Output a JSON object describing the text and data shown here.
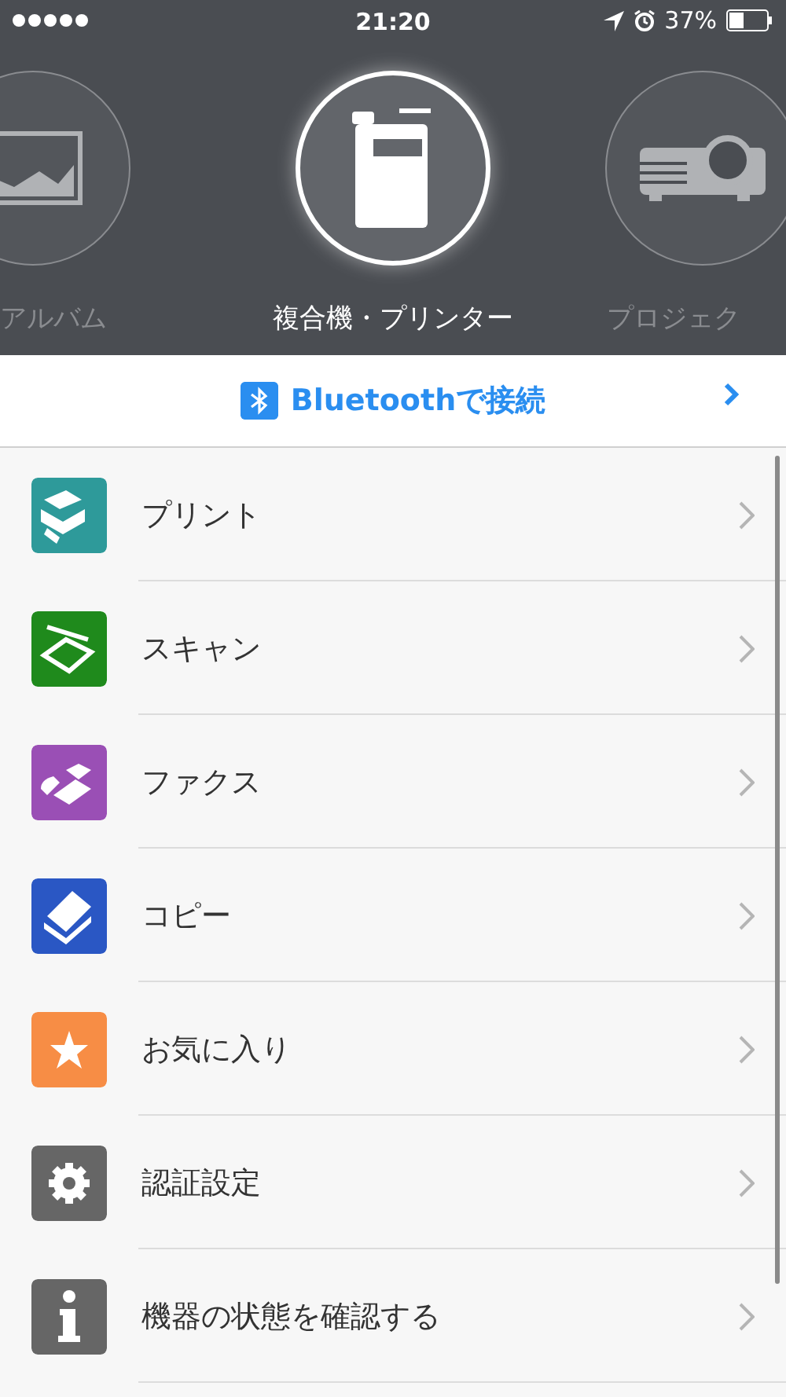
{
  "status_bar": {
    "time": "21:20",
    "battery_text": "37%"
  },
  "devices": [
    {
      "kind": "album",
      "label": "アルバム",
      "selected": false
    },
    {
      "kind": "printer",
      "label": "複合機・プリンター",
      "selected": true
    },
    {
      "kind": "projector",
      "label": "プロジェク",
      "selected": false
    }
  ],
  "bluetooth": {
    "label": "Bluetoothで接続"
  },
  "menu": [
    {
      "kind": "print",
      "label": "プリント",
      "color": "#2e9a9a"
    },
    {
      "kind": "scan",
      "label": "スキャン",
      "color": "#1f8a1c"
    },
    {
      "kind": "fax",
      "label": "ファクス",
      "color": "#9a4fb5"
    },
    {
      "kind": "copy",
      "label": "コピー",
      "color": "#2a57c4"
    },
    {
      "kind": "favorite",
      "label": "お気に入り",
      "color": "#f78d45"
    },
    {
      "kind": "auth",
      "label": "認証設定",
      "color": "#666666"
    },
    {
      "kind": "info",
      "label": "機器の状態を確認する",
      "color": "#666666"
    }
  ]
}
